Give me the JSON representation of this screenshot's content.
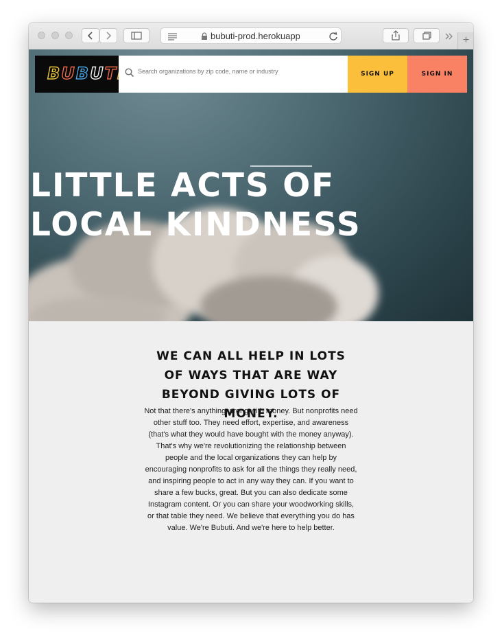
{
  "browser": {
    "url": "bubuti-prod.herokuapp",
    "icons": [
      "back-icon",
      "forward-icon",
      "sidebar-icon",
      "reader-icon",
      "lock-icon",
      "reload-icon",
      "share-icon",
      "tabs-icon",
      "more-icon",
      "new-tab-icon"
    ]
  },
  "nav": {
    "logo": "BUBUTI",
    "search_placeholder": "Search organizations by zip code, name or industry",
    "signup": "SIGN UP",
    "signin": "SIGN IN"
  },
  "hero": {
    "title": "LITTLE ACTS OF LOCAL KINDNESS"
  },
  "intro": {
    "heading": "WE CAN ALL HELP IN LOTS OF WAYS THAT ARE WAY BEYOND GIVING LOTS OF MONEY.",
    "body": "Not that there's anything wrong with money. But nonprofits need other stuff too. They need effort, expertise, and awareness (that's what they would have bought with the money anyway). That's why we're revolutionizing the relationship between people and the local organizations they can help by encouraging nonprofits to ask for all the things they really need, and inspiring people to act in any way they can. If you want to share a few bucks, great. But you can also dedicate some Instagram content. Or you can share your woodworking skills, or that table they need. We believe that everything you do has value. We're Bubuti. And we're here to help better."
  },
  "colors": {
    "signup": "#fcbf3b",
    "signin": "#f98264",
    "logo_letters": [
      "#e9c53a",
      "#e86a4a",
      "#4aa3de",
      "#f1f1f1",
      "#e86a4a",
      "#e9c53a"
    ]
  }
}
